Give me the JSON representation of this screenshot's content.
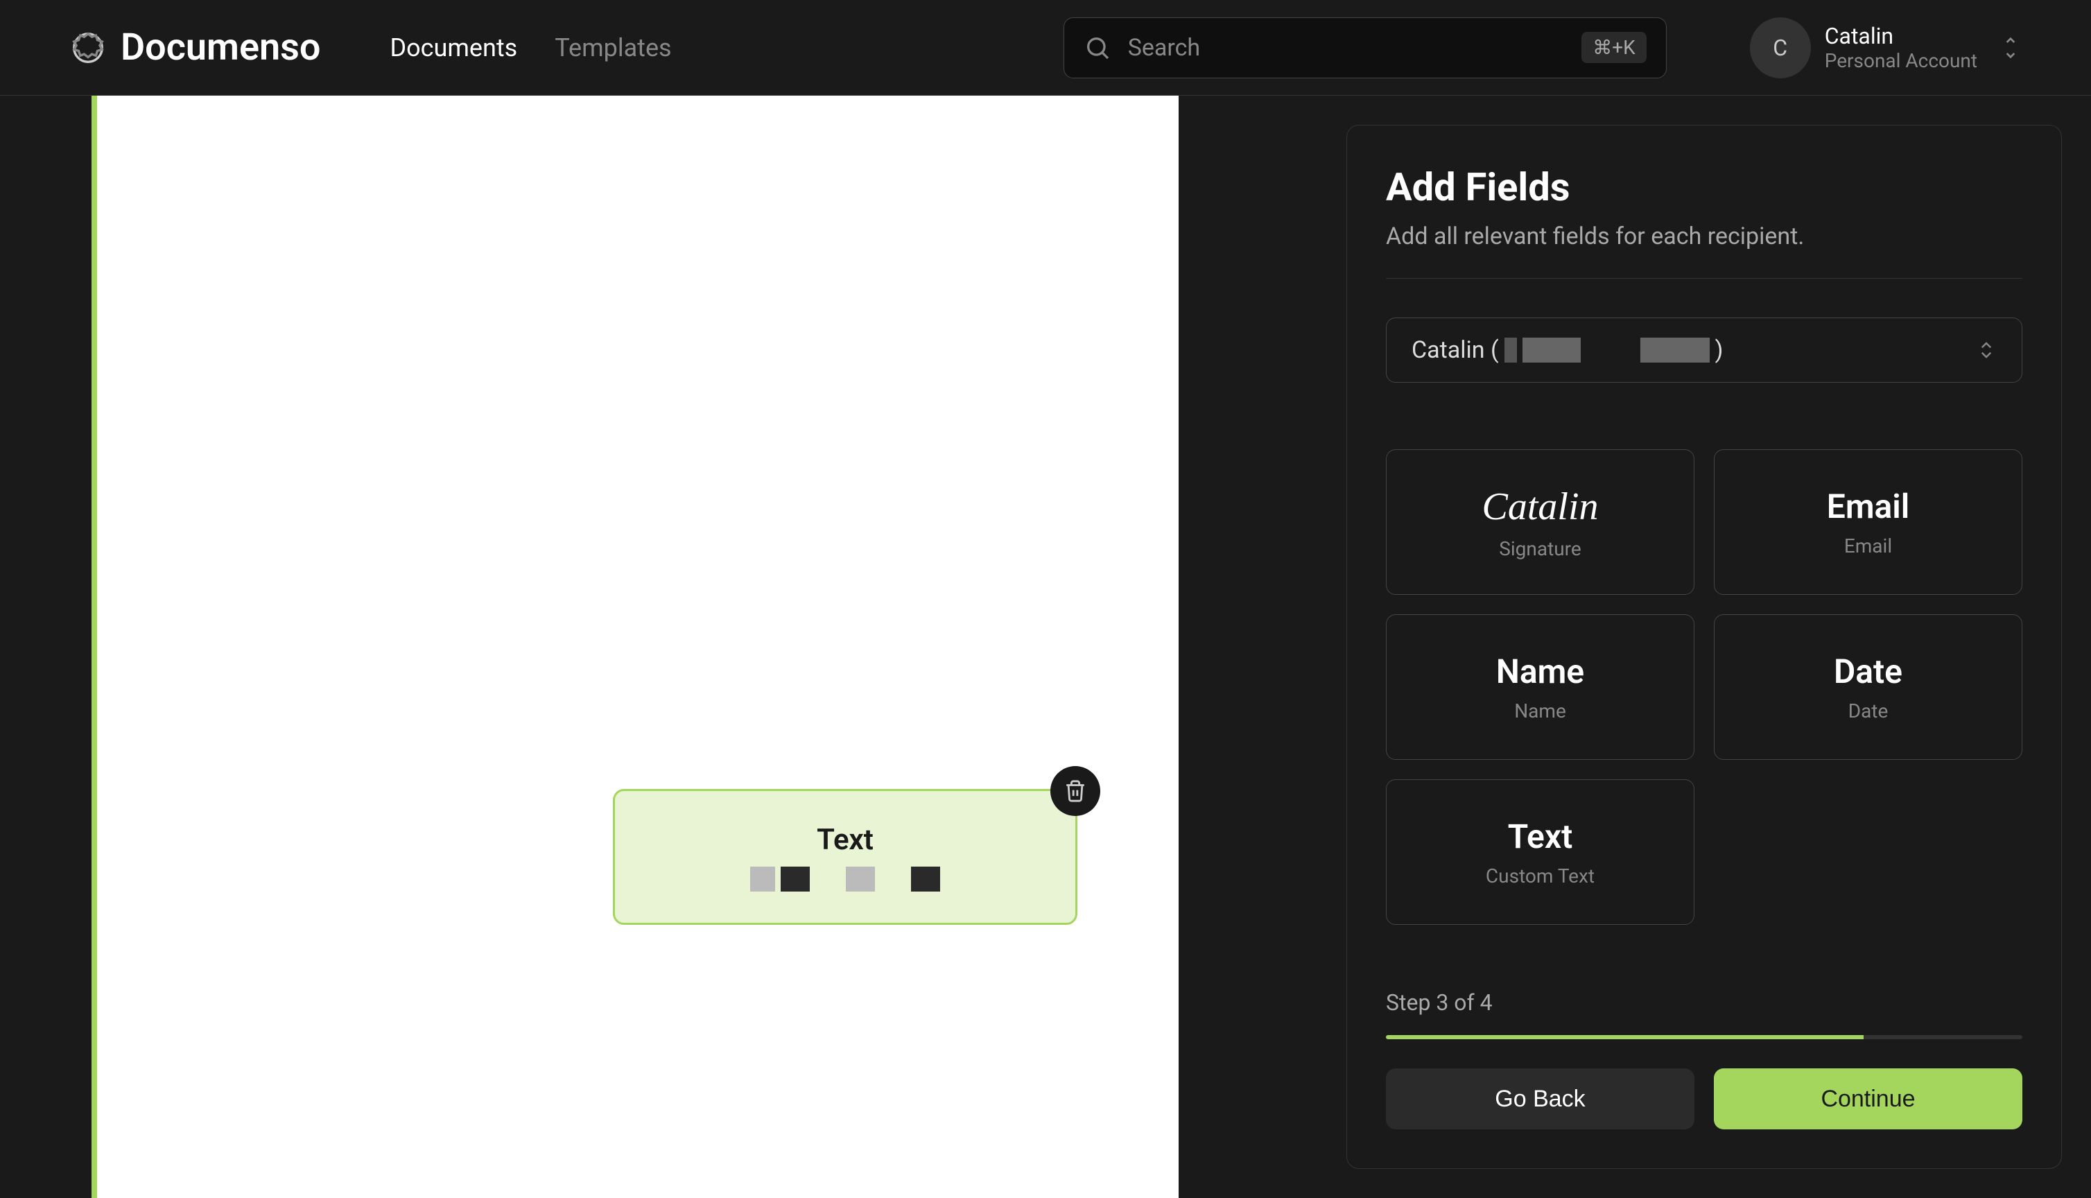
{
  "header": {
    "brand": "Documenso",
    "nav": {
      "documents": "Documents",
      "templates": "Templates"
    },
    "search": {
      "placeholder": "Search",
      "kbd": "⌘+K"
    },
    "account": {
      "initial": "C",
      "name": "Catalin",
      "type": "Personal Account"
    }
  },
  "doc_field": {
    "title": "Text"
  },
  "panel": {
    "title": "Add Fields",
    "subtitle": "Add all relevant fields for each recipient.",
    "recipient_prefix": "Catalin (",
    "recipient_suffix": ")",
    "fields": {
      "signature": {
        "title": "Catalin",
        "sub": "Signature"
      },
      "email": {
        "title": "Email",
        "sub": "Email"
      },
      "name": {
        "title": "Name",
        "sub": "Name"
      },
      "date": {
        "title": "Date",
        "sub": "Date"
      },
      "text": {
        "title": "Text",
        "sub": "Custom Text"
      }
    },
    "step": "Step 3 of 4",
    "back": "Go Back",
    "continue": "Continue"
  }
}
